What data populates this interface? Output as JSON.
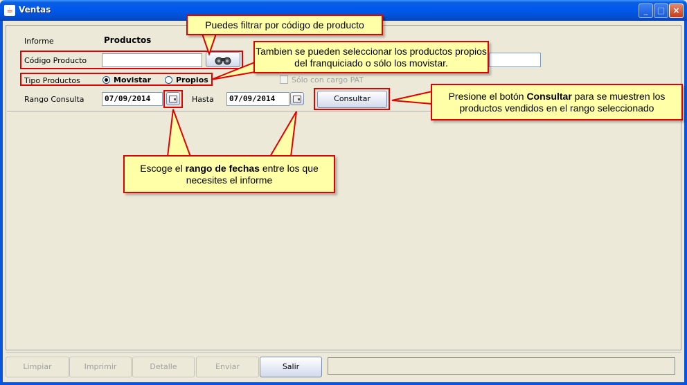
{
  "window": {
    "title": "Ventas",
    "icon": "java-cup-icon"
  },
  "form": {
    "informe_label": "Informe",
    "informe_value": "Productos",
    "codigo_label": "Código Producto",
    "codigo_value": "",
    "search_icon": "binoculars-icon",
    "tipo_label": "Tipo Productos",
    "tipo_options": [
      "Movistar",
      "Propios"
    ],
    "tipo_selected": "Movistar",
    "solo_cargo_label": "Sólo con cargo PAT",
    "rango_label": "Rango Consulta",
    "fecha_desde": "07/09/2014",
    "hasta_label": "Hasta",
    "fecha_hasta": "07/09/2014",
    "calendar_icon": "calendar-icon",
    "consultar_label": "Consultar",
    "descripcion_value": ""
  },
  "footer": {
    "buttons": [
      "Limpiar",
      "Imprimir",
      "Detalle",
      "Enviar",
      "Salir"
    ],
    "status_text": ""
  },
  "callouts": {
    "codigo": "Puedes filtrar por código de producto",
    "tipo": "Tambien se pueden seleccionar los productos propios del franquiciado o sólo los movistar.",
    "consultar_pre": "Presione el botón ",
    "consultar_bold": "Consultar",
    "consultar_post": " para se muestren los productos vendidos en el rango seleccionado",
    "fechas_pre": "Escoge el ",
    "fechas_bold": "rango de fechas",
    "fechas_post": " entre los que necesites el informe"
  },
  "colors": {
    "callout_bg": "#ffffa8",
    "callout_border": "#e00000",
    "titlebar": "#0058ee"
  }
}
